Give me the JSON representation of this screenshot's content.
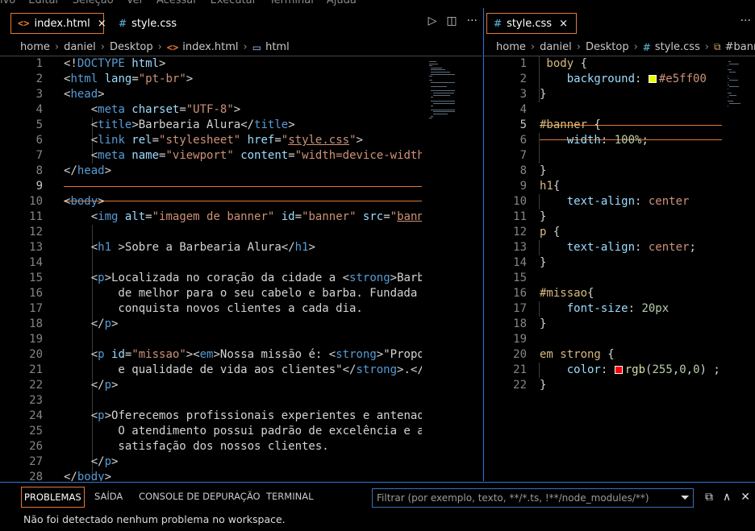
{
  "menubar": [
    "ivo",
    "Editar",
    "Seleção",
    "Ver",
    "Acessar",
    "Executar",
    "Terminal",
    "Ajuda"
  ],
  "left": {
    "tabs": [
      {
        "label": "index.html",
        "icon": "html-file-icon",
        "active": true,
        "close": "×"
      },
      {
        "label": "style.css",
        "icon": "css-file-icon",
        "active": false
      }
    ],
    "tab_icon_html": "<>",
    "tab_icon_css": "#",
    "actions": [
      "▷",
      "◫",
      "···"
    ],
    "breadcrumb": [
      "home",
      "daniel",
      "Desktop",
      "index.html",
      "html"
    ],
    "current_line": 9,
    "lines": [
      [
        [
          "t-punc",
          "<!"
        ],
        [
          "t-tag",
          "DOCTYPE"
        ],
        [
          "t-attr",
          " html"
        ],
        [
          "t-punc",
          ">"
        ]
      ],
      [
        [
          "t-punc",
          "<"
        ],
        [
          "t-tag",
          "html"
        ],
        [
          "t-attr",
          " lang"
        ],
        [
          "t-punc",
          "="
        ],
        [
          "t-str",
          "\"pt-br\""
        ],
        [
          "t-punc",
          ">"
        ]
      ],
      [
        [
          "t-punc",
          "<"
        ],
        [
          "t-tag",
          "head"
        ],
        [
          "t-punc",
          ">"
        ]
      ],
      [
        [
          "t-txt",
          "    "
        ],
        [
          "t-punc",
          "<"
        ],
        [
          "t-tag",
          "meta"
        ],
        [
          "t-attr",
          " charset"
        ],
        [
          "t-punc",
          "="
        ],
        [
          "t-str",
          "\"UTF-8\""
        ],
        [
          "t-punc",
          ">"
        ]
      ],
      [
        [
          "t-txt",
          "    "
        ],
        [
          "t-punc",
          "<"
        ],
        [
          "t-tag",
          "title"
        ],
        [
          "t-punc",
          ">"
        ],
        [
          "t-txt",
          "Barbearia Alura"
        ],
        [
          "t-punc",
          "</"
        ],
        [
          "t-tag",
          "title"
        ],
        [
          "t-punc",
          ">"
        ]
      ],
      [
        [
          "t-txt",
          "    "
        ],
        [
          "t-punc",
          "<"
        ],
        [
          "t-tag",
          "link"
        ],
        [
          "t-attr",
          " rel"
        ],
        [
          "t-punc",
          "="
        ],
        [
          "t-str",
          "\"stylesheet\""
        ],
        [
          "t-attr",
          " href"
        ],
        [
          "t-punc",
          "="
        ],
        [
          "t-str",
          "\""
        ],
        [
          "t-str t-link",
          "style.css"
        ],
        [
          "t-str",
          "\""
        ],
        [
          "t-punc",
          ">"
        ]
      ],
      [
        [
          "t-txt",
          "    "
        ],
        [
          "t-punc",
          "<"
        ],
        [
          "t-tag",
          "meta"
        ],
        [
          "t-attr",
          " name"
        ],
        [
          "t-punc",
          "="
        ],
        [
          "t-str",
          "\"viewport\""
        ],
        [
          "t-attr",
          " content"
        ],
        [
          "t-punc",
          "="
        ],
        [
          "t-str",
          "\"width=device-width"
        ]
      ],
      [
        [
          "t-punc",
          "</"
        ],
        [
          "t-tag",
          "head"
        ],
        [
          "t-punc",
          ">"
        ]
      ],
      [],
      [
        [
          "t-punc",
          "<"
        ],
        [
          "t-tag",
          "body"
        ],
        [
          "t-punc",
          ">"
        ]
      ],
      [
        [
          "t-txt",
          "    "
        ],
        [
          "t-punc",
          "<"
        ],
        [
          "t-tag",
          "img"
        ],
        [
          "t-attr",
          " alt"
        ],
        [
          "t-punc",
          "="
        ],
        [
          "t-str",
          "\"imagem de banner\""
        ],
        [
          "t-attr",
          " id"
        ],
        [
          "t-punc",
          "="
        ],
        [
          "t-str",
          "\"banner\""
        ],
        [
          "t-attr",
          " src"
        ],
        [
          "t-punc",
          "="
        ],
        [
          "t-str",
          "\""
        ],
        [
          "t-str t-link",
          "bann"
        ]
      ],
      [],
      [
        [
          "t-txt",
          "    "
        ],
        [
          "t-punc",
          "<"
        ],
        [
          "t-tag",
          "h1"
        ],
        [
          "t-txt",
          " "
        ],
        [
          "t-punc",
          ">"
        ],
        [
          "t-txt",
          "Sobre a Barbearia Alura"
        ],
        [
          "t-punc",
          "</"
        ],
        [
          "t-tag",
          "h1"
        ],
        [
          "t-punc",
          ">"
        ]
      ],
      [],
      [
        [
          "t-txt",
          "    "
        ],
        [
          "t-punc",
          "<"
        ],
        [
          "t-tag",
          "p"
        ],
        [
          "t-punc",
          ">"
        ],
        [
          "t-txt",
          "Localizada no coração da cidade a "
        ],
        [
          "t-punc",
          "<"
        ],
        [
          "t-tag",
          "strong"
        ],
        [
          "t-punc",
          ">"
        ],
        [
          "t-txt",
          "Barb"
        ]
      ],
      [
        [
          "t-txt",
          "        de melhor para o seu cabelo e barba. Fundada"
        ]
      ],
      [
        [
          "t-txt",
          "        conquista novos clientes a cada dia."
        ]
      ],
      [
        [
          "t-txt",
          "    "
        ],
        [
          "t-punc",
          "</"
        ],
        [
          "t-tag",
          "p"
        ],
        [
          "t-punc",
          ">"
        ]
      ],
      [],
      [
        [
          "t-txt",
          "    "
        ],
        [
          "t-punc",
          "<"
        ],
        [
          "t-tag",
          "p"
        ],
        [
          "t-attr",
          " id"
        ],
        [
          "t-punc",
          "="
        ],
        [
          "t-str",
          "\"missao\""
        ],
        [
          "t-punc",
          "><"
        ],
        [
          "t-tag",
          "em"
        ],
        [
          "t-punc",
          ">"
        ],
        [
          "t-txt",
          "Nossa missão é: "
        ],
        [
          "t-punc",
          "<"
        ],
        [
          "t-tag",
          "strong"
        ],
        [
          "t-punc",
          ">"
        ],
        [
          "t-txt",
          "\"Propo"
        ]
      ],
      [
        [
          "t-txt",
          "        e qualidade de vida aos clientes\""
        ],
        [
          "t-punc",
          "</"
        ],
        [
          "t-tag",
          "strong"
        ],
        [
          "t-punc",
          ">"
        ],
        [
          "t-txt",
          "."
        ],
        [
          "t-punc",
          "</"
        ]
      ],
      [
        [
          "t-txt",
          "    "
        ],
        [
          "t-punc",
          "</"
        ],
        [
          "t-tag",
          "p"
        ],
        [
          "t-punc",
          ">"
        ]
      ],
      [],
      [
        [
          "t-txt",
          "    "
        ],
        [
          "t-punc",
          "<"
        ],
        [
          "t-tag",
          "p"
        ],
        [
          "t-punc",
          ">"
        ],
        [
          "t-txt",
          "Oferecemos profissionais experientes e antenad"
        ]
      ],
      [
        [
          "t-txt",
          "        O atendimento possui padrão de excelência e a"
        ]
      ],
      [
        [
          "t-txt",
          "        satisfação dos nossos clientes."
        ]
      ],
      [
        [
          "t-txt",
          "    "
        ],
        [
          "t-punc",
          "</"
        ],
        [
          "t-tag",
          "p"
        ],
        [
          "t-punc",
          ">"
        ]
      ],
      [
        [
          "t-punc",
          "</"
        ],
        [
          "t-tag",
          "body"
        ],
        [
          "t-punc",
          ">"
        ]
      ]
    ]
  },
  "right": {
    "tabs": [
      {
        "label": "style.css",
        "icon": "css-file-icon",
        "active": true,
        "close": "×"
      }
    ],
    "tab_icon_css": "#",
    "actions": [
      "···"
    ],
    "breadcrumb": [
      "home",
      "daniel",
      "Desktop",
      "style.css",
      "#banner"
    ],
    "current_line": 5,
    "swatches": {
      "yellow": "#e5ff00",
      "red": "#ff0000"
    },
    "lines": [
      [
        [
          "t-sel",
          " body"
        ],
        [
          "t-punc",
          " {"
        ]
      ],
      [
        [
          "t-txt",
          "    "
        ],
        [
          "t-prop",
          "background"
        ],
        [
          "t-punc",
          ": "
        ],
        [
          "swatch",
          "#e5ff00"
        ],
        [
          "t-val",
          "#e5ff00"
        ]
      ],
      [
        [
          "t-punc",
          "}"
        ]
      ],
      [],
      [
        [
          "t-sel",
          "#banner"
        ],
        [
          "t-punc",
          " {"
        ]
      ],
      [
        [
          "t-txt",
          "    "
        ],
        [
          "t-prop",
          "width"
        ],
        [
          "t-punc",
          ": "
        ],
        [
          "t-num",
          "100%"
        ],
        [
          "t-punc",
          ";"
        ]
      ],
      [],
      [
        [
          "t-punc",
          "}"
        ]
      ],
      [
        [
          "t-sel",
          "h1"
        ],
        [
          "t-punc",
          "{"
        ]
      ],
      [
        [
          "t-txt",
          "    "
        ],
        [
          "t-prop",
          "text-align"
        ],
        [
          "t-punc",
          ": "
        ],
        [
          "t-val",
          "center"
        ]
      ],
      [
        [
          "t-punc",
          "}"
        ]
      ],
      [
        [
          "t-sel",
          "p"
        ],
        [
          "t-punc",
          " {"
        ]
      ],
      [
        [
          "t-txt",
          "    "
        ],
        [
          "t-prop",
          "text-align"
        ],
        [
          "t-punc",
          ": "
        ],
        [
          "t-val",
          "center"
        ],
        [
          "t-punc",
          ";"
        ]
      ],
      [
        [
          "t-punc",
          "}"
        ]
      ],
      [],
      [
        [
          "t-sel",
          "#missao"
        ],
        [
          "t-punc",
          "{"
        ]
      ],
      [
        [
          "t-txt",
          "    "
        ],
        [
          "t-prop",
          "font-size"
        ],
        [
          "t-punc",
          ": "
        ],
        [
          "t-num",
          "20px"
        ]
      ],
      [
        [
          "t-punc",
          "}"
        ]
      ],
      [],
      [
        [
          "t-sel",
          "em strong"
        ],
        [
          "t-punc",
          " {"
        ]
      ],
      [
        [
          "t-txt",
          "    "
        ],
        [
          "t-prop",
          "color"
        ],
        [
          "t-punc",
          ": "
        ],
        [
          "swatch",
          "#ff0000"
        ],
        [
          "t-fn",
          "rgb"
        ],
        [
          "t-punc",
          "("
        ],
        [
          "t-num",
          "255"
        ],
        [
          "t-punc",
          ","
        ],
        [
          "t-num",
          "0"
        ],
        [
          "t-punc",
          ","
        ],
        [
          "t-num",
          "0"
        ],
        [
          "t-punc",
          ") ;"
        ]
      ],
      [
        [
          "t-punc",
          "}"
        ]
      ]
    ]
  },
  "panel": {
    "tabs": [
      "PROBLEMAS",
      "SAÍDA",
      "CONSOLE DE DEPURAÇÃO",
      "TERMINAL"
    ],
    "active_tab": 0,
    "filter_placeholder": "Filtrar (por exemplo, texto, **/*.ts, !**/node_modules/**)",
    "message": "Não foi detectado nenhum problema no workspace.",
    "buttons": [
      "⧉",
      "∧",
      "✕"
    ],
    "filter_icon": "⏷"
  }
}
